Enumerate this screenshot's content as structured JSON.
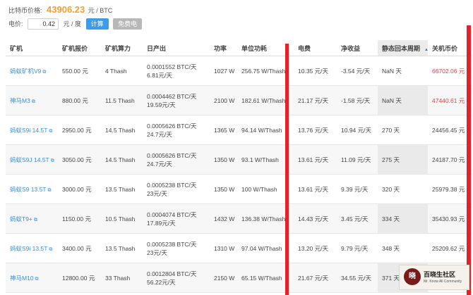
{
  "header": {
    "btc_price_label": "比特币价格:",
    "btc_price_value": "43906.23",
    "btc_price_unit": "元 / BTC",
    "electricity_label": "电价:",
    "electricity_value": "0.42",
    "electricity_unit": "元 / 度",
    "calc_button": "计算",
    "free_button": "免费电"
  },
  "table": {
    "columns": [
      "矿机",
      "矿机报价",
      "矿机算力",
      "日产出",
      "功率",
      "单位功耗",
      "电费",
      "净收益",
      "静态回本周期",
      "关机币价"
    ],
    "sort_arrow": "▲",
    "rows": [
      {
        "miner": "蚂蚁矿机V9",
        "price": "550.00 元",
        "hashrate": "4 Thash",
        "daily_btc": "0.0001552 BTC/天",
        "daily_cny": "6.81元/天",
        "power": "1027 W",
        "efficiency": "256.75 W/Thash",
        "elec_cost": "10.35 元/天",
        "net": "-3.54 元/天",
        "payback": "NaN 天",
        "shutdown": "66702.06 元",
        "shutdown_red": true
      },
      {
        "miner": "神马M3",
        "price": "880.00 元",
        "hashrate": "11.5 Thash",
        "daily_btc": "0.0004462 BTC/天",
        "daily_cny": "19.59元/天",
        "power": "2100 W",
        "efficiency": "182.61 W/Thash",
        "elec_cost": "21.17 元/天",
        "net": "-1.58 元/天",
        "payback": "NaN 天",
        "shutdown": "47440.61 元",
        "shutdown_red": true
      },
      {
        "miner": "蚂蚁S9i 14.5T",
        "price": "2950.00 元",
        "hashrate": "14.5 Thash",
        "daily_btc": "0.0005626 BTC/天",
        "daily_cny": "24.7元/天",
        "power": "1365 W",
        "efficiency": "94.14 W/Thash",
        "elec_cost": "13.76 元/天",
        "net": "10.94 元/天",
        "payback": "270 天",
        "shutdown": "24456.45 元",
        "shutdown_red": false
      },
      {
        "miner": "蚂蚁S9J 14.5T",
        "price": "3050.00 元",
        "hashrate": "14.5 Thash",
        "daily_btc": "0.0005626 BTC/天",
        "daily_cny": "24.7元/天",
        "power": "1350 W",
        "efficiency": "93.1 W/Thash",
        "elec_cost": "13.61 元/天",
        "net": "11.09 元/天",
        "payback": "275 天",
        "shutdown": "24187.70 元",
        "shutdown_red": false
      },
      {
        "miner": "蚂蚁S9 13.5T",
        "price": "3000.00 元",
        "hashrate": "13.5 Thash",
        "daily_btc": "0.0005238 BTC/天",
        "daily_cny": "23元/天",
        "power": "1350 W",
        "efficiency": "100 W/Thash",
        "elec_cost": "13.61 元/天",
        "net": "9.39 元/天",
        "payback": "320 天",
        "shutdown": "25979.38 元",
        "shutdown_red": false
      },
      {
        "miner": "蚂蚁T9+",
        "price": "1150.00 元",
        "hashrate": "10.5 Thash",
        "daily_btc": "0.0004074 BTC/天",
        "daily_cny": "17.89元/天",
        "power": "1432 W",
        "efficiency": "136.38 W/Thash",
        "elec_cost": "14.43 元/天",
        "net": "3.45 元/天",
        "payback": "334 天",
        "shutdown": "35430.93 元",
        "shutdown_red": false
      },
      {
        "miner": "蚂蚁S9i 13.5T",
        "price": "3400.00 元",
        "hashrate": "13.5 Thash",
        "daily_btc": "0.0005238 BTC/天",
        "daily_cny": "23元/天",
        "power": "1310 W",
        "efficiency": "97.04 W/Thash",
        "elec_cost": "13.20 元/天",
        "net": "9.79 元/天",
        "payback": "348 天",
        "shutdown": "25209.62 元",
        "shutdown_red": false
      },
      {
        "miner": "神马M10",
        "price": "12800.00 元",
        "hashrate": "33 Thash",
        "daily_btc": "0.0012804 BTC/天",
        "daily_cny": "56.22元/天",
        "power": "2150 W",
        "efficiency": "65.15 W/Thash",
        "elec_cost": "21.67 元/天",
        "net": "34.55 元/天",
        "payback": "371 天",
        "shutdown": "",
        "shutdown_red": false
      }
    ]
  },
  "watermark": {
    "seal_char": "晓",
    "title": "百晓生社区",
    "subtitle": "Mr. Know All Community"
  },
  "colors": {
    "accent": "#3d9be9",
    "price": "#f0a030",
    "highlight_bar": "#e4202a",
    "negative": "#e04545"
  }
}
